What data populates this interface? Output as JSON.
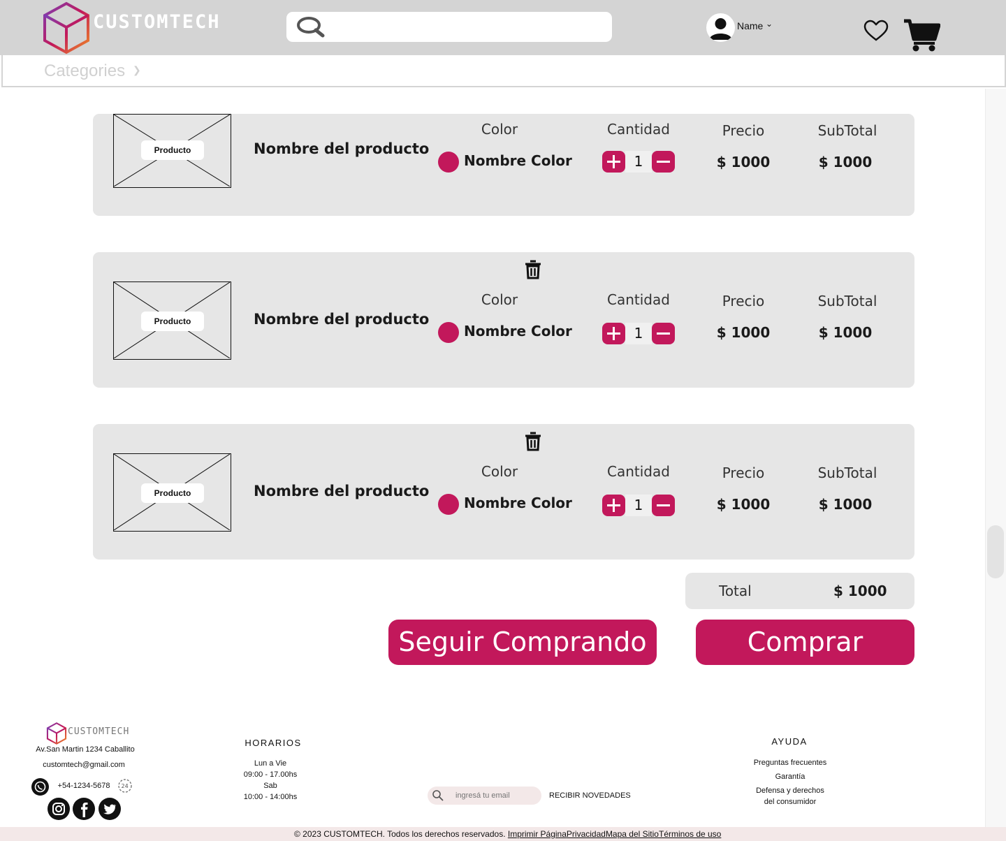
{
  "header": {
    "brand": "CUSTOMTECH",
    "search_placeholder": "",
    "user_name": "Name",
    "brand_color": "#c2185b"
  },
  "categories": {
    "label": "Categories"
  },
  "cart": {
    "columns": {
      "color": "Color",
      "quantity": "Cantidad",
      "price": "Precio",
      "subtotal": "SubTotal"
    },
    "items": [
      {
        "image_label": "Producto",
        "name": "Nombre del producto",
        "color_name": "Nombre Color",
        "color_hex": "#c2185b",
        "quantity": "1",
        "price": "$ 1000",
        "subtotal": "$ 1000"
      },
      {
        "image_label": "Producto",
        "name": "Nombre del producto",
        "color_name": "Nombre Color",
        "color_hex": "#c2185b",
        "quantity": "1",
        "price": "$ 1000",
        "subtotal": "$ 1000"
      },
      {
        "image_label": "Producto",
        "name": "Nombre del producto",
        "color_name": "Nombre Color",
        "color_hex": "#c2185b",
        "quantity": "1",
        "price": "$ 1000",
        "subtotal": "$ 1000"
      }
    ],
    "total_label": "Total",
    "total_value": "$ 1000",
    "continue_label": "Seguir Comprando",
    "buy_label": "Comprar"
  },
  "footer": {
    "brand": "CUSTOMTECH",
    "address": "Av.San Martin 1234 Caballito",
    "email": "customtech@gmail.com",
    "phone": "+54-1234-5678",
    "hours_title": "HORARIOS",
    "hours_weekdays": "Lun a Vie",
    "hours_weekdays_time": "09:00 - 17.00hs",
    "hours_sat": "Sab",
    "hours_sat_time": "10:00 - 14:00hs",
    "newsletter_placeholder": "ingresá tu email",
    "newsletter_button": "RECIBIR NOVEDADES",
    "help_title": "AYUDA",
    "help_faq": "Preguntas frecuentes",
    "help_warranty": "Garantía",
    "help_rights_1": "Defensa y derechos",
    "help_rights_2": "del consumidor",
    "copyright": "© 2023 CUSTOMTECH. Todos los derechos reservados.",
    "links": [
      "Imprimir Página",
      "Privacidad",
      "Mapa del Sitio",
      "Términos de uso"
    ],
    "icons": [
      "whatsapp-icon",
      "24h-support-icon",
      "instagram-icon",
      "facebook-icon",
      "twitter-icon"
    ]
  }
}
